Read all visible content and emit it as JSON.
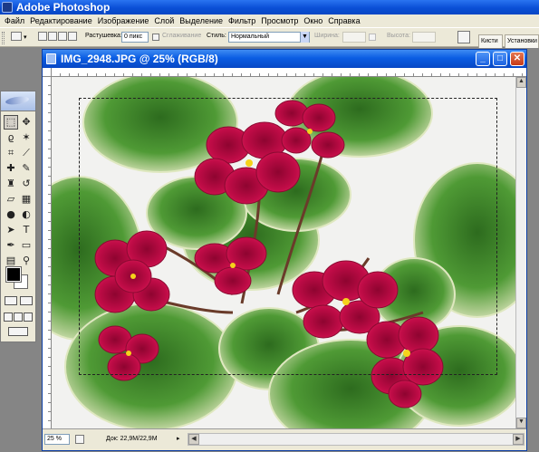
{
  "app": {
    "title": "Adobe Photoshop"
  },
  "menu": [
    "Файл",
    "Редактирование",
    "Изображение",
    "Слой",
    "Выделение",
    "Фильтр",
    "Просмотр",
    "Окно",
    "Справка"
  ],
  "options_bar": {
    "feather_label": "Растушевка:",
    "feather_value": "0 пикс",
    "antialias_label": "Сглаживание",
    "style_label": "Стиль:",
    "style_value": "Нормальный",
    "width_label": "Ширина:",
    "height_label": "Высота:",
    "tab_brushes": "Кисти",
    "tab_presets": "Установки"
  },
  "toolbox": {
    "tools": [
      {
        "name": "rectangular-marquee-tool",
        "glyph": "⬚",
        "active": true
      },
      {
        "name": "move-tool",
        "glyph": "✥"
      },
      {
        "name": "lasso-tool",
        "glyph": "ϱ"
      },
      {
        "name": "magic-wand-tool",
        "glyph": "✶"
      },
      {
        "name": "crop-tool",
        "glyph": "⌗"
      },
      {
        "name": "slice-tool",
        "glyph": "⟋"
      },
      {
        "name": "healing-brush-tool",
        "glyph": "✚"
      },
      {
        "name": "brush-tool",
        "glyph": "✎"
      },
      {
        "name": "clone-stamp-tool",
        "glyph": "♜"
      },
      {
        "name": "history-brush-tool",
        "glyph": "↺"
      },
      {
        "name": "eraser-tool",
        "glyph": "▱"
      },
      {
        "name": "gradient-tool",
        "glyph": "▦"
      },
      {
        "name": "blur-tool",
        "glyph": "●"
      },
      {
        "name": "dodge-tool",
        "glyph": "◐"
      },
      {
        "name": "path-selection-tool",
        "glyph": "➤"
      },
      {
        "name": "type-tool",
        "glyph": "T"
      },
      {
        "name": "pen-tool",
        "glyph": "✒"
      },
      {
        "name": "shape-tool",
        "glyph": "▭"
      },
      {
        "name": "notes-tool",
        "glyph": "▤"
      },
      {
        "name": "eyedropper-tool",
        "glyph": "⚲"
      },
      {
        "name": "hand-tool",
        "glyph": "✋"
      },
      {
        "name": "zoom-tool",
        "glyph": "⌕"
      }
    ]
  },
  "document": {
    "title": "IMG_2948.JPG @ 25% (RGB/8)",
    "zoom": "25 %",
    "doc_info": "Док: 22,9M/22,9M"
  },
  "colors": {
    "titlebar": "#0b5de3",
    "close_button": "#c63a17",
    "workspace": "#858585",
    "flower": "#b3073c",
    "leaf": "#3e8a2a",
    "leaf_edge": "#e2ebc4"
  }
}
